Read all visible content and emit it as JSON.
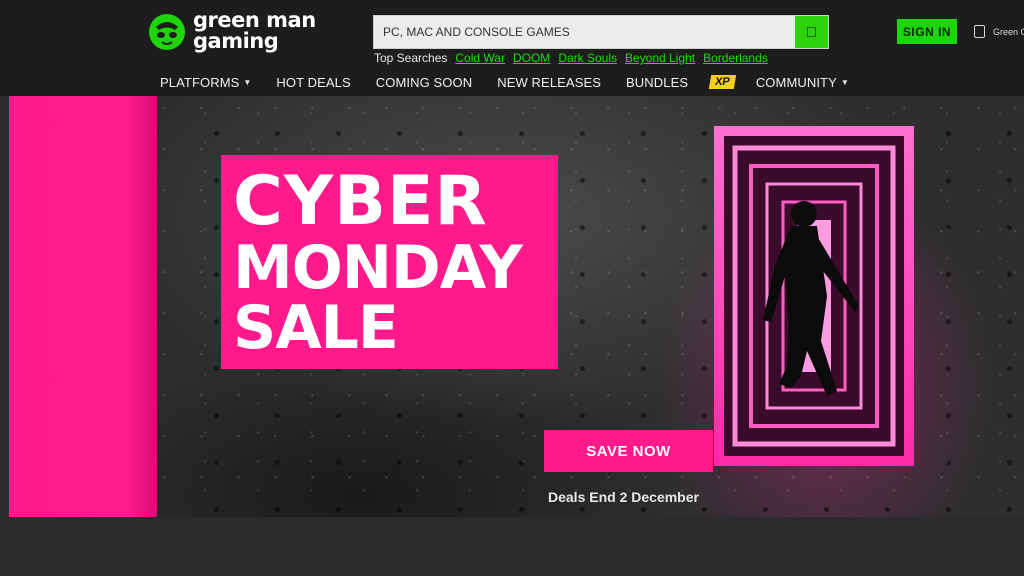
{
  "brand": {
    "name_line1": "green man",
    "name_line2": "gaming",
    "accent_color": "#1ed40a",
    "logo_icon": "green-man-logo-icon"
  },
  "search": {
    "placeholder": "PC, MAC AND CONSOLE GAMES",
    "button_icon": "search-icon",
    "top_searches_label": "Top Searches",
    "top_searches": [
      "Cold War",
      "DOOM",
      "Dark Souls",
      "Beyond Light",
      "Borderlands"
    ]
  },
  "account": {
    "signin_label": "SIGN IN",
    "region_label": "Green G"
  },
  "nav": {
    "platforms": "PLATFORMS",
    "hot_deals": "HOT DEALS",
    "coming_soon": "COMING SOON",
    "new_releases": "NEW RELEASES",
    "bundles": "BUNDLES",
    "xp_badge": "XP",
    "community": "COMMUNITY",
    "dropdown_icon": "caret-down-icon"
  },
  "hero": {
    "title_line1": "CYBER",
    "title_line2": "MONDAY",
    "title_line3": "SALE",
    "cta_label": "SAVE NOW",
    "footnote": "Deals End 2 December",
    "pink_color": "#ff1a8c"
  }
}
